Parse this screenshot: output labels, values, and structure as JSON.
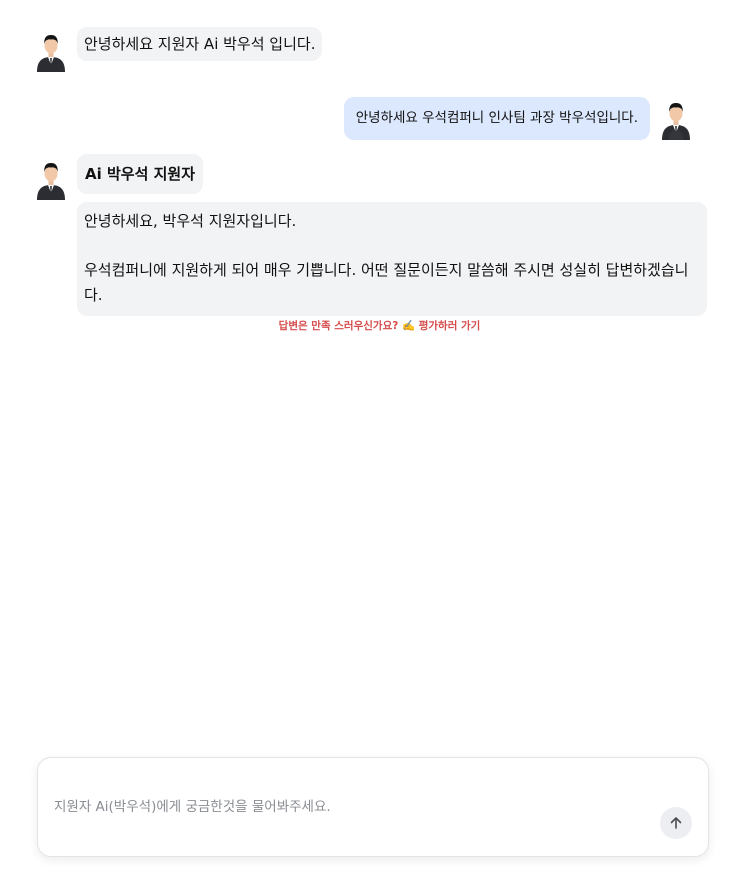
{
  "chat": {
    "messages": [
      {
        "role": "assistant",
        "text": "안녕하세요 지원자 Ai 박우석 입니다."
      },
      {
        "role": "user",
        "text": "안녕하세요 우석컴퍼니 인사팀 과장 박우석입니다."
      },
      {
        "role": "assistant",
        "name": "Ai 박우석 지원자",
        "paragraphs": [
          "안녕하세요, 박우석 지원자입니다.",
          "우석컴퍼니에 지원하게 되어 매우 기쁩니다. 어떤 질문이든지 말씀해 주시면 성실히 답변하겠습니다."
        ]
      }
    ],
    "feedback": {
      "text": "답변은 만족 스러우신가요?",
      "icon": "writing-hand-icon",
      "icon_glyph": "✍️",
      "link": "평가하러 가기",
      "color": "#d64b4b"
    }
  },
  "composer": {
    "placeholder": "지원자 Ai(박우석)에게 궁금한것을 물어봐주세요.",
    "value": "",
    "send_icon": "arrow-up-icon"
  },
  "colors": {
    "assistant_bubble": "#f2f3f5",
    "user_bubble": "#dce8fd"
  }
}
